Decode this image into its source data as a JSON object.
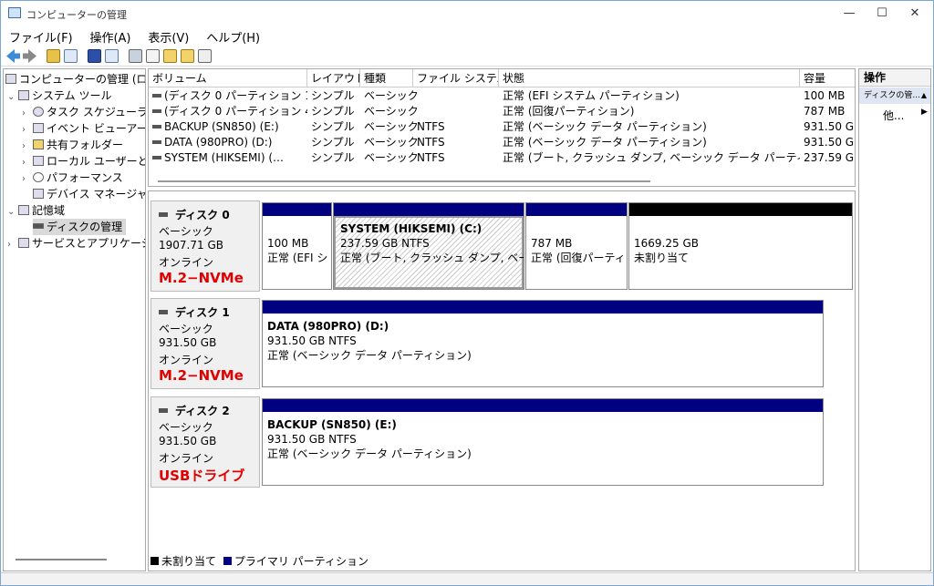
{
  "window": {
    "title": "コンピューターの管理",
    "minimize": "—",
    "maximize": "☐",
    "close": "✕"
  },
  "menu": [
    "ファイル(F)",
    "操作(A)",
    "表示(V)",
    "ヘルプ(H)"
  ],
  "tree": {
    "root": "コンピューターの管理 (ロ",
    "system_tools": "システム ツール",
    "task_scheduler": "タスク スケジューラ",
    "event_viewer": "イベント ビューアー",
    "shared_folders": "共有フォルダー",
    "local_users": "ローカル ユーザーとグ",
    "performance": "パフォーマンス",
    "device_manager": "デバイス マネージャー",
    "storage": "記憶域",
    "disk_management": "ディスクの管理",
    "services": "サービスとアプリケーション"
  },
  "volumes": {
    "headers": [
      "ボリューム",
      "レイアウト",
      "種類",
      "ファイル システム",
      "状態",
      "容量"
    ],
    "rows": [
      [
        "(ディスク 0 パーティション 1)",
        "シンプル",
        "ベーシック",
        "",
        "正常 (EFI システム パーティション)",
        "100 MB"
      ],
      [
        "(ディスク 0 パーティション 4)",
        "シンプル",
        "ベーシック",
        "",
        "正常 (回復パーティション)",
        "787 MB"
      ],
      [
        "BACKUP (SN850) (E:)",
        "シンプル",
        "ベーシック",
        "NTFS",
        "正常 (ベーシック データ パーティション)",
        "931.50 G"
      ],
      [
        "DATA (980PRO) (D:)",
        "シンプル",
        "ベーシック",
        "NTFS",
        "正常 (ベーシック データ パーティション)",
        "931.50 G"
      ],
      [
        "SYSTEM (HIKSEMI) (…",
        "シンプル",
        "ベーシック",
        "NTFS",
        "正常 (ブート, クラッシュ ダンプ, ベーシック データ パーティション)",
        "237.59 G"
      ]
    ]
  },
  "disks": [
    {
      "name": "ディスク 0",
      "type": "ベーシック",
      "size": "1907.71 GB",
      "status": "オンライン",
      "note": "M.2−NVMe",
      "partitions": [
        {
          "title": "",
          "size": "100 MB",
          "status": "正常 (EFI シ"
        },
        {
          "title": "SYSTEM (HIKSEMI) (C:)",
          "size": "237.59 GB NTFS",
          "status": "正常 (ブート, クラッシュ ダンプ, ベーシ"
        },
        {
          "title": "",
          "size": "787 MB",
          "status": "正常 (回復パーティ"
        },
        {
          "title": "",
          "size": "1669.25 GB",
          "status": "未割り当て"
        }
      ]
    },
    {
      "name": "ディスク 1",
      "type": "ベーシック",
      "size": "931.50 GB",
      "status": "オンライン",
      "note": "M.2−NVMe",
      "partitions": [
        {
          "title": "DATA (980PRO) (D:)",
          "size": "931.50 GB NTFS",
          "status": "正常 (ベーシック データ パーティション)"
        }
      ]
    },
    {
      "name": "ディスク 2",
      "type": "ベーシック",
      "size": "931.50 GB",
      "status": "オンライン",
      "note": "USBドライブ",
      "partitions": [
        {
          "title": "BACKUP (SN850) (E:)",
          "size": "931.50 GB NTFS",
          "status": "正常 (ベーシック データ パーティション)"
        }
      ]
    }
  ],
  "legend": {
    "unallocated": "未割り当て",
    "primary": "プライマリ パーティション",
    "unallocated_color": "#000000",
    "primary_color": "#000080"
  },
  "actions": {
    "header": "操作",
    "section": "ディスクの管...",
    "section_arrow": "▲",
    "more": "他...",
    "more_arrow": "▶"
  }
}
